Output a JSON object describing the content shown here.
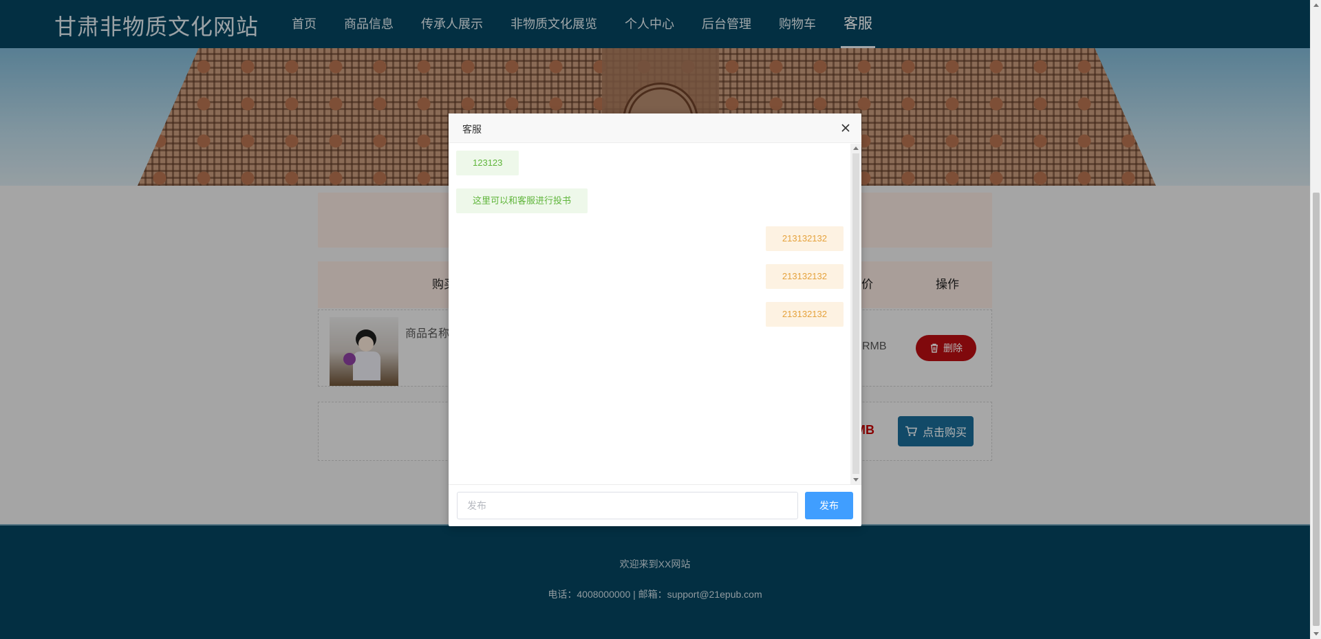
{
  "header": {
    "site_title": "甘肃非物质文化网站",
    "nav": [
      {
        "label": "首页"
      },
      {
        "label": "商品信息"
      },
      {
        "label": "传承人展示"
      },
      {
        "label": "非物质文化展览"
      },
      {
        "label": "个人中心"
      },
      {
        "label": "后台管理"
      },
      {
        "label": "购物车"
      },
      {
        "label": "客服",
        "active": true
      }
    ]
  },
  "cart": {
    "columns": {
      "buy": "购买",
      "price_partial": "价",
      "action": "操作"
    },
    "item": {
      "name_partial": "商品名称",
      "price_partial": "RMB",
      "delete_label": "删除"
    },
    "total_partial": "MB",
    "buy_label": "点击购买"
  },
  "footer": {
    "welcome": "欢迎来到XX网站",
    "contact": "电话：4008000000 | 邮箱：support@21epub.com"
  },
  "dialog": {
    "title": "客服",
    "messages": [
      {
        "side": "left",
        "text": "123123"
      },
      {
        "side": "left",
        "text": "这里可以和客服进行投书"
      },
      {
        "side": "right",
        "text": "213132132"
      },
      {
        "side": "right",
        "text": "213132132"
      },
      {
        "side": "right",
        "text": "213132132"
      }
    ],
    "input_placeholder": "发布",
    "send_label": "发布"
  },
  "colors": {
    "header_bg": "#05445f",
    "left_bubble_bg": "#eef8ea",
    "left_bubble_text": "#5fb53a",
    "right_bubble_bg": "#fdf2e2",
    "right_bubble_text": "#e5a23c",
    "send_button": "#409eff",
    "delete_button": "#b80e12",
    "buy_button": "#1a6a95"
  }
}
